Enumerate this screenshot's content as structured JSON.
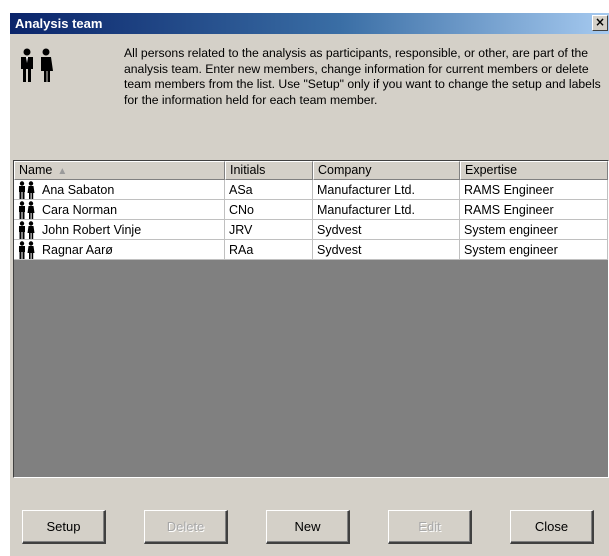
{
  "window": {
    "title": "Analysis team",
    "close_label": "×"
  },
  "description": "All persons related to the analysis as participants, responsible, or other, are part of the analysis team. Enter new members, change information for current members or delete team members from the list. Use \"Setup\" only if you want to change the setup and labels for the information held for each team member.",
  "table": {
    "columns": [
      {
        "label": "Name",
        "sort": "▲"
      },
      {
        "label": "Initials"
      },
      {
        "label": "Company"
      },
      {
        "label": "Expertise"
      }
    ],
    "rows": [
      {
        "name": "Ana Sabaton",
        "initials": "ASa",
        "company": "Manufacturer Ltd.",
        "expertise": "RAMS Engineer"
      },
      {
        "name": "Cara Norman",
        "initials": "CNo",
        "company": "Manufacturer Ltd.",
        "expertise": "RAMS Engineer"
      },
      {
        "name": "John Robert Vinje",
        "initials": "JRV",
        "company": "Sydvest",
        "expertise": "System engineer"
      },
      {
        "name": "Ragnar Aarø",
        "initials": "RAa",
        "company": "Sydvest",
        "expertise": "System engineer"
      }
    ]
  },
  "buttons": {
    "setup": "Setup",
    "delete": "Delete",
    "new": "New",
    "edit": "Edit",
    "close": "Close"
  },
  "icons": {
    "team": "team-people-icon",
    "member": "person-pair-icon"
  }
}
